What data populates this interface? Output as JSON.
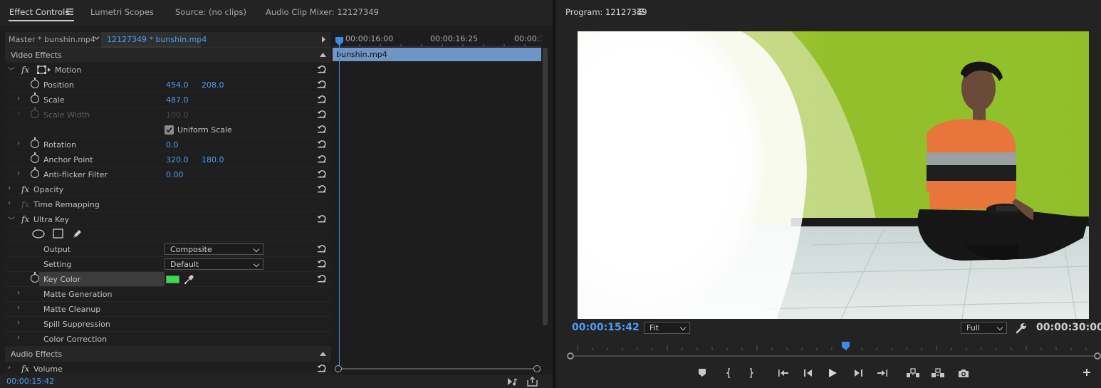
{
  "tabs": {
    "effect_controls": "Effect Controls",
    "lumetri": "Lumetri Scopes",
    "source": "Source: (no clips)",
    "mixer": "Audio Clip Mixer: 12127349"
  },
  "clip_selector": {
    "master": "Master * bunshin.mp4",
    "sequence": "12127349 * bunshin.mp4"
  },
  "timeline": {
    "ticks": [
      "00:00:16:00",
      "00:00:16:25",
      "00:00:1"
    ],
    "clip_name": "bunshin.mp4"
  },
  "effects": {
    "video_header": "Video Effects",
    "motion": "Motion",
    "position": {
      "label": "Position",
      "x": "454.0",
      "y": "208.0"
    },
    "scale": {
      "label": "Scale",
      "value": "487.0"
    },
    "scale_width": {
      "label": "Scale Width",
      "value": "100.0"
    },
    "uniform_scale": "Uniform Scale",
    "rotation": {
      "label": "Rotation",
      "value": "0.0"
    },
    "anchor": {
      "label": "Anchor Point",
      "x": "320.0",
      "y": "180.0"
    },
    "antiflicker": {
      "label": "Anti-flicker Filter",
      "value": "0.00"
    },
    "opacity": "Opacity",
    "time_remap": "Time Remapping",
    "ultra_key": "Ultra Key",
    "output": {
      "label": "Output",
      "value": "Composite"
    },
    "setting": {
      "label": "Setting",
      "value": "Default"
    },
    "key_color": {
      "label": "Key Color",
      "color": "#2fe04a"
    },
    "matte_gen": "Matte Generation",
    "matte_clean": "Matte Cleanup",
    "spill": "Spill Suppression",
    "color_corr": "Color Correction",
    "audio_header": "Audio Effects",
    "volume": "Volume"
  },
  "left_timecode": "00:00:15:42",
  "program": {
    "title": "Program: 12127349",
    "timecode": "00:00:15:42",
    "fit": "Fit",
    "quality": "Full",
    "duration": "00:00:30:00"
  },
  "colors": {
    "accent": "#4d9ef6",
    "clip_bar": "#6f95c7",
    "key_color": "#2fe04a"
  }
}
